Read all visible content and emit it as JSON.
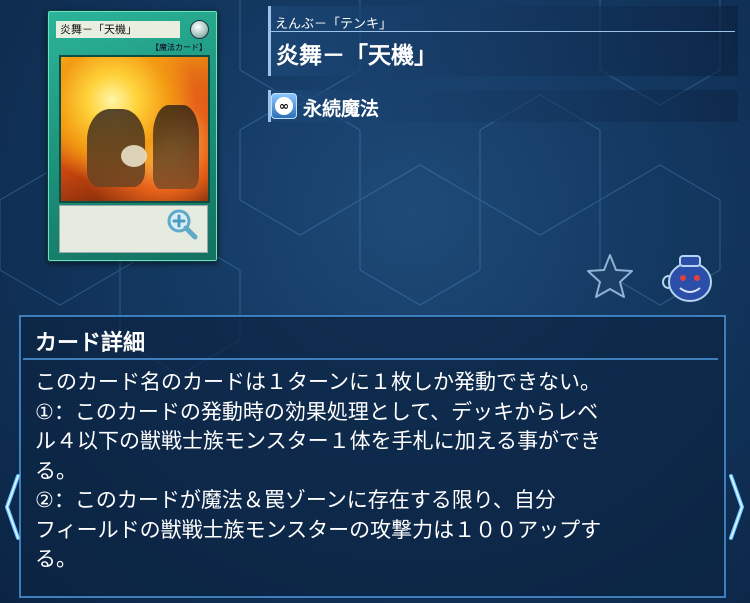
{
  "card": {
    "image_name": "炎舞－「天機」",
    "image_type": "【魔法カード】"
  },
  "header": {
    "kana": "えんぶ－「テンキ」",
    "title": "炎舞－「天機」"
  },
  "type": {
    "icon": "continuous-icon",
    "icon_glyph": "∞",
    "label": "永続魔法"
  },
  "details": {
    "heading": "カード詳細",
    "lines": [
      "このカード名のカードは１ターンに１枚しか発動できない。",
      "①：このカードの発動時の効果処理として、デッキからレベ",
      "ル４以下の獣戦士族モンスター１体を手札に加える事ができ",
      "る。",
      "②：このカードが魔法＆罠ゾーンに存在する限り、自分",
      "フィールドの獣戦士族モンスターの攻撃力は１００アップす",
      "る。"
    ]
  },
  "colors": {
    "background": "#143a63",
    "accent": "#3d7fbd",
    "card_frame": "#1c8f78"
  }
}
